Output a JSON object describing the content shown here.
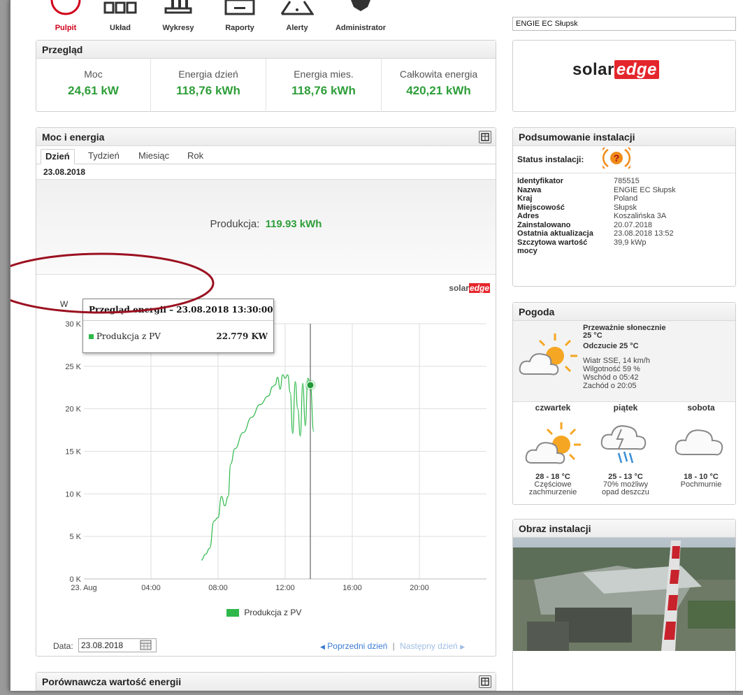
{
  "nav": {
    "items": [
      {
        "label": "Pulpit",
        "icon": "dashboard-icon",
        "active": true
      },
      {
        "label": "Układ",
        "icon": "layout-icon",
        "active": false
      },
      {
        "label": "Wykresy",
        "icon": "charts-icon",
        "active": false
      },
      {
        "label": "Raporty",
        "icon": "reports-icon",
        "active": false
      },
      {
        "label": "Alerty",
        "icon": "alerts-icon",
        "active": false
      },
      {
        "label": "Administrator",
        "icon": "admin-gear-icon",
        "active": false
      }
    ],
    "site_selected": "ENGIE EC Słupsk"
  },
  "overview": {
    "title": "Przegląd",
    "cells": [
      {
        "label": "Moc",
        "value": "24,61 kW"
      },
      {
        "label": "Energia dzień",
        "value": "118,76 kWh"
      },
      {
        "label": "Energia mies.",
        "value": "118,76 kWh"
      },
      {
        "label": "Całkowita energia",
        "value": "420,21 kWh"
      }
    ]
  },
  "brand": {
    "solar": "solar",
    "edge": "edge",
    "color_solar": "#222222",
    "color_edge": "#e4262c"
  },
  "power": {
    "title": "Moc i energia",
    "tabs": [
      "Dzień",
      "Tydzień",
      "Miesiąc",
      "Rok"
    ],
    "active_tab": "Dzień",
    "date": "23.08.2018",
    "production_label": "Produkcja:",
    "production_value": "119.93 kWh",
    "date_label": "Data:",
    "date_value": "23.08.2018",
    "prev_day": "Poprzedni dzień",
    "separator": "|",
    "next_day": "Następny dzień"
  },
  "tooltip": {
    "title": "Przegląd energii – 23.08.2018 13:30:00",
    "series": "Produkcja z PV",
    "value": "22.779 KW"
  },
  "chart_data": {
    "type": "line",
    "ylabel": "W",
    "y_unit": "W",
    "ylim": [
      0,
      30000
    ],
    "y_ticks": [
      0,
      5000,
      10000,
      15000,
      20000,
      25000,
      30000
    ],
    "y_tick_labels": [
      "0 K",
      "5 K",
      "10 K",
      "15 K",
      "20 K",
      "25 K",
      "30 K"
    ],
    "x_range": [
      "2018-08-23 00:00",
      "2018-08-24 00:00"
    ],
    "x_tick_labels": [
      "23. Aug",
      "04:00",
      "08:00",
      "12:00",
      "16:00",
      "20:00"
    ],
    "x_ticks_hours": [
      0,
      4,
      8,
      12,
      16,
      20
    ],
    "legend": "bottom-center",
    "grid": true,
    "series": [
      {
        "name": "Produkcja z PV",
        "color": "#2eb84a",
        "x_hours": [
          7.0,
          7.25,
          7.5,
          7.75,
          8.0,
          8.2,
          8.4,
          8.6,
          8.75,
          9.0,
          9.5,
          10.0,
          10.5,
          11.0,
          11.25,
          11.4,
          11.55,
          11.7,
          11.85,
          12.0,
          12.15,
          12.3,
          12.45,
          12.6,
          12.75,
          12.9,
          13.05,
          13.2,
          13.35,
          13.5,
          13.7
        ],
        "values": [
          2200,
          2900,
          3600,
          6800,
          7200,
          9700,
          8600,
          9700,
          13500,
          15300,
          17200,
          19000,
          20500,
          21500,
          22600,
          22800,
          23700,
          22300,
          24000,
          23600,
          24000,
          21900,
          17100,
          23200,
          20000,
          16800,
          23000,
          18000,
          23600,
          22800,
          17300
        ]
      }
    ],
    "highlight": {
      "x_hours": 13.5,
      "value": 22779
    }
  },
  "summary": {
    "title": "Podsumowanie instalacji",
    "status_label": "Status instalacji:",
    "rows": [
      {
        "k": "Identyfikator",
        "v": "785515"
      },
      {
        "k": "Nazwa",
        "v": "ENGIE EC Słupsk"
      },
      {
        "k": "Kraj",
        "v": "Poland"
      },
      {
        "k": "Miejscowość",
        "v": "Słupsk"
      },
      {
        "k": "Adres",
        "v": "Koszalińska 3A"
      },
      {
        "k": "Zainstalowano",
        "v": "20.07.2018"
      },
      {
        "k": "Ostatnia aktualizacja",
        "v": "23.08.2018 13:52"
      },
      {
        "k": "Szczytowa wartość mocy",
        "v": "39,9 kWp"
      }
    ]
  },
  "weather": {
    "title": "Pogoda",
    "condition": "Przeważnie słonecznie",
    "temp": "25 °C",
    "feels": "Odczucie 25 °C",
    "wind": "Wiatr SSE, 14 km/h",
    "humidity": "Wilgotność 59 %",
    "sunrise": "Wschód o 05:42",
    "sunset": "Zachód o 20:05",
    "forecast": [
      {
        "day": "czwartek",
        "temp": "28 - 18 °C",
        "desc1": "Częściowe",
        "desc2": "zachmurzenie",
        "icon": "partly-cloudy-icon"
      },
      {
        "day": "piątek",
        "temp": "25 - 13 °C",
        "desc1": "70% możliwy",
        "desc2": "opad deszczu",
        "icon": "storm-rain-icon"
      },
      {
        "day": "sobota",
        "temp": "18 - 10 °C",
        "desc1": "Pochmurnie",
        "desc2": "",
        "icon": "cloud-icon"
      }
    ]
  },
  "image_panel": {
    "title": "Obraz instalacji"
  },
  "compare": {
    "title": "Porównawcza wartość energii"
  }
}
